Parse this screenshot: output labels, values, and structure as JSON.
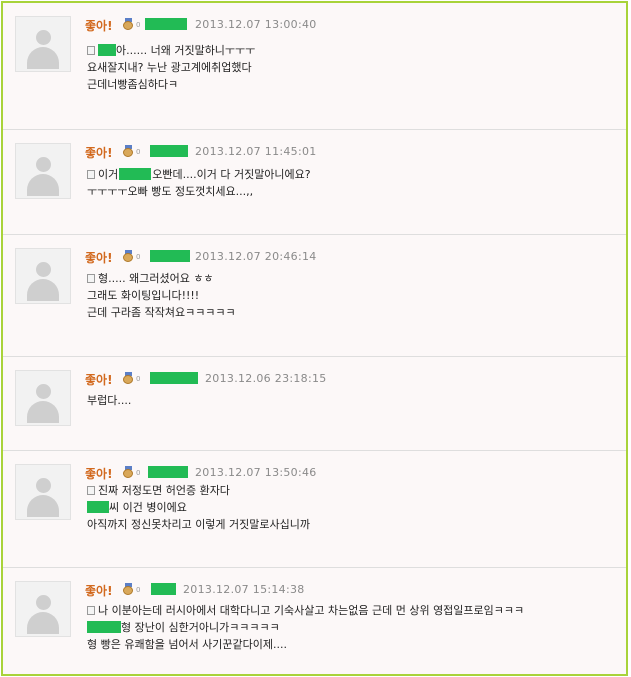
{
  "like_label": "좋아!",
  "tiny_mark": "0",
  "icons": {
    "avatar": "default-user-avatar-icon",
    "medal": "medal-icon",
    "doc": "document-icon"
  },
  "colors": {
    "like": "#d2691e",
    "redaction": "#22bb55",
    "border": "#a8d33a"
  },
  "comments": [
    {
      "date": "2013.12.07 13:00:40",
      "lines": [
        {
          "a": "",
          "b": "아...... 너왜 거짓말하니ㅜㅜㅜ"
        },
        {
          "a": "요새잘지내? 누난 광고계에취업했다",
          "b": ""
        },
        {
          "a": "근데너빵좀심하다ㅋ",
          "b": ""
        }
      ]
    },
    {
      "date": "2013.12.07 11:45:01",
      "lines": [
        {
          "a": "이거",
          "b": "오빤데....이거 다 거짓말아니에요?"
        },
        {
          "a": "ㅜㅜㅜㅜ오빠 빵도 정도껏치세요...,,",
          "b": ""
        }
      ]
    },
    {
      "date": "2013.12.07 20:46:14",
      "lines": [
        {
          "a": "형..... 왜그러셨어요 ㅎㅎ",
          "b": ""
        },
        {
          "a": "그래도 화이팅입니다!!!!",
          "b": ""
        },
        {
          "a": "근데 구라좀 작작쳐요ㅋㅋㅋㅋㅋ",
          "b": ""
        }
      ]
    },
    {
      "date": "2013.12.06 23:18:15",
      "lines": [
        {
          "a": "부럽다....",
          "b": ""
        }
      ]
    },
    {
      "date": "2013.12.07 13:50:46",
      "lines": [
        {
          "a": "진짜 저정도면 허언증 환자다",
          "b": ""
        },
        {
          "a": "",
          "b": "씨 이건 병이에요"
        },
        {
          "a": "아직까지 정신못차리고 이렇게 거짓말로사십니까",
          "b": ""
        }
      ]
    },
    {
      "date": "2013.12.07 15:14:38",
      "lines": [
        {
          "a": "나 이분아는데 러시아에서 대학다니고 기숙사살고 차는없음 근데 먼 상위 영접일프로임ㅋㅋㅋ",
          "b": ""
        },
        {
          "a": "",
          "b": "형 장난이 심한거아니가ㅋㅋㅋㅋㅋ"
        },
        {
          "a": "형 빵은 유쾌함을 넘어서 사기꾼같다이제....",
          "b": ""
        }
      ]
    }
  ]
}
